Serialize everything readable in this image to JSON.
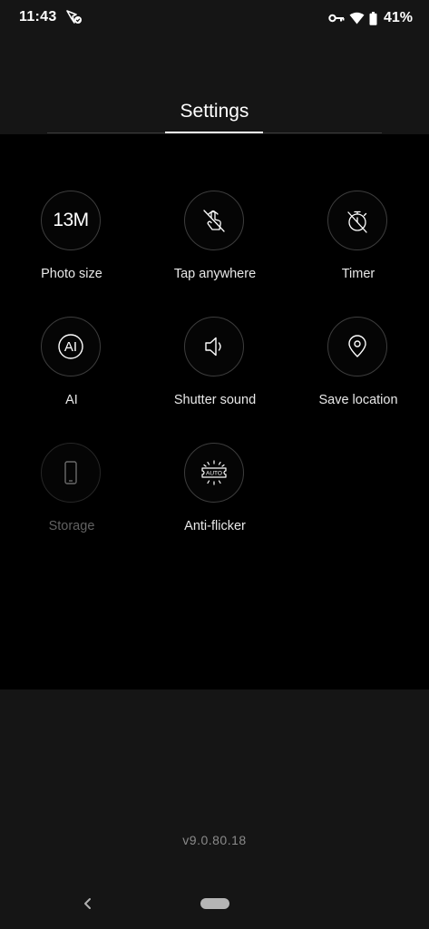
{
  "status_bar": {
    "time": "11:43",
    "battery": "41%"
  },
  "header": {
    "title": "Settings"
  },
  "settings": [
    {
      "label": "Photo size",
      "value": "13M",
      "icon": "photo-size-icon"
    },
    {
      "label": "Tap anywhere",
      "icon": "tap-anywhere-icon"
    },
    {
      "label": "Timer",
      "icon": "timer-off-icon"
    },
    {
      "label": "AI",
      "value": "AI",
      "icon": "ai-icon"
    },
    {
      "label": "Shutter sound",
      "icon": "shutter-sound-icon"
    },
    {
      "label": "Save location",
      "icon": "location-pin-icon"
    },
    {
      "label": "Storage",
      "icon": "phone-storage-icon",
      "disabled": true
    },
    {
      "label": "Anti-flicker",
      "value": "AUTO",
      "icon": "anti-flicker-icon"
    }
  ],
  "version": "v9.0.80.18",
  "colors": {
    "background": "#151515",
    "panel": "#000000",
    "text": "#ffffff",
    "disabled_text": "#616161"
  }
}
